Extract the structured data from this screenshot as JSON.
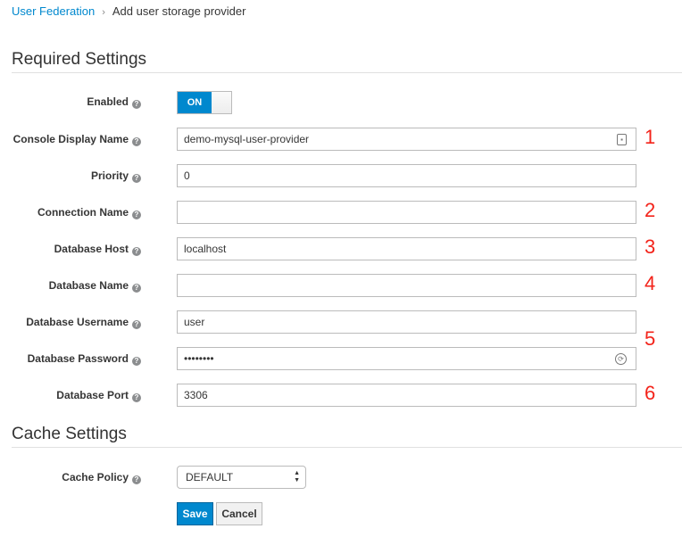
{
  "breadcrumb": {
    "parent": "User Federation",
    "current": "Add user storage provider"
  },
  "sections": {
    "required": "Required Settings",
    "cache": "Cache Settings"
  },
  "enabled": {
    "label": "Enabled",
    "value": "ON"
  },
  "fields": [
    {
      "label": "Console Display Name",
      "value": "demo-mysql-user-provider",
      "annotation": "1",
      "icon": "contact-card-icon"
    },
    {
      "label": "Priority",
      "value": "0",
      "annotation": ""
    },
    {
      "label": "Connection Name",
      "value": "",
      "annotation": "2"
    },
    {
      "label": "Database Host",
      "value": "localhost",
      "annotation": "3"
    },
    {
      "label": "Database Name",
      "value": "",
      "annotation": "4"
    },
    {
      "label": "Database Username",
      "value": "user",
      "annotation": ""
    },
    {
      "label": "Database Password",
      "value": "••••••••",
      "annotation": "",
      "icon": "password-key-icon"
    },
    {
      "label": "Database Port",
      "value": "3306",
      "annotation": "6"
    }
  ],
  "group_annotation": "5",
  "cache": {
    "label": "Cache Policy",
    "value": "DEFAULT"
  },
  "buttons": {
    "save": "Save",
    "cancel": "Cancel"
  },
  "colors": {
    "primary": "#0088ce",
    "annotation": "#f3231a"
  }
}
